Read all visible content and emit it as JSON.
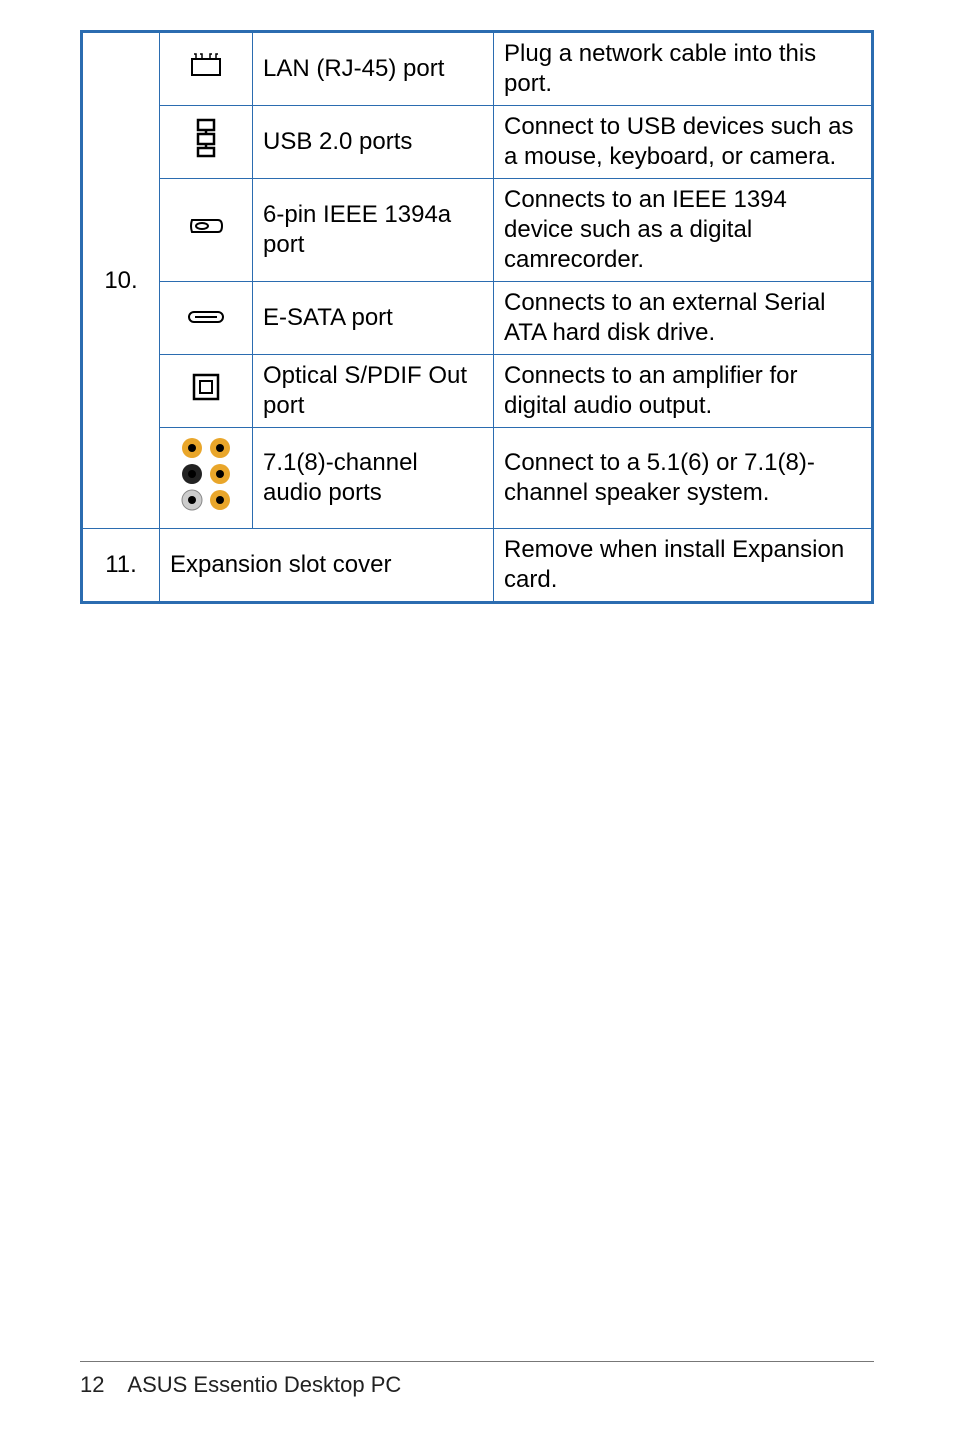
{
  "table": {
    "row10_number": "10.",
    "rows": [
      {
        "icon": "rj45-icon",
        "label": "LAN (RJ-45) port",
        "desc": "Plug a network cable into this port."
      },
      {
        "icon": "usb-chain-icon",
        "label": "USB 2.0 ports",
        "desc": "Connect to USB devices such as a mouse, keyboard, or camera."
      },
      {
        "icon": "ieee1394-icon",
        "label": "6-pin IEEE 1394a port",
        "desc": "Connects to an IEEE 1394 device such as a digital camrecorder."
      },
      {
        "icon": "esata-icon",
        "label": "E-SATA port",
        "desc": "Connects to an external Serial ATA hard disk drive."
      },
      {
        "icon": "optical-spdif-icon",
        "label": "Optical S/PDIF Out port",
        "desc": "Connects to an amplifier for digital audio output."
      },
      {
        "icon": "audio-jacks-icon",
        "label": "7.1(8)-channel audio ports",
        "desc": "Connect to a 5.1(6) or 7.1(8)-channel speaker system."
      }
    ],
    "row11_number": "11.",
    "row11_label": "Expansion slot cover",
    "row11_desc": "Remove when install Expansion card."
  },
  "footer": {
    "page_number": "12",
    "product": "ASUS Essentio Desktop PC"
  }
}
